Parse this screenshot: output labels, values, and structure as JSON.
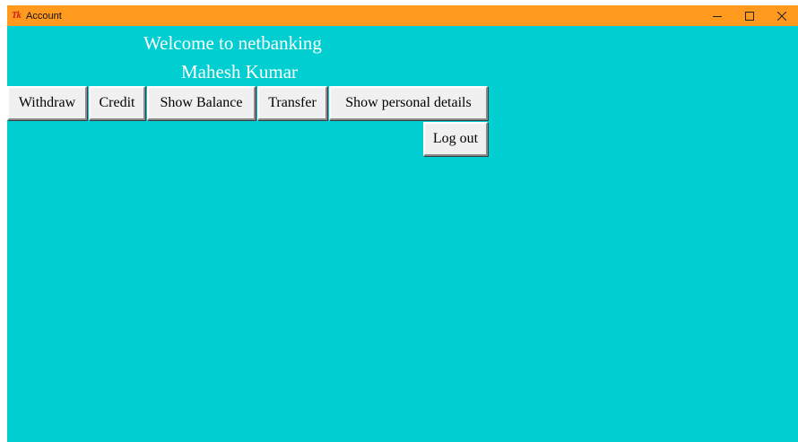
{
  "window": {
    "title": "Account",
    "app_icon": "tk-icon",
    "app_icon_text": "Tk",
    "background_color": "#00CED1",
    "titlebar_color": "#FF9A1F",
    "controls": [
      "minimize-icon",
      "maximize-icon",
      "close-icon"
    ]
  },
  "main": {
    "welcome_text": "Welcome to netbanking",
    "user_name": "Mahesh Kumar",
    "buttons": {
      "withdraw": "Withdraw",
      "credit": "Credit",
      "show_balance": "Show Balance",
      "transfer": "Transfer",
      "show_personal_details": "Show personal details",
      "log_out": "Log out"
    }
  }
}
